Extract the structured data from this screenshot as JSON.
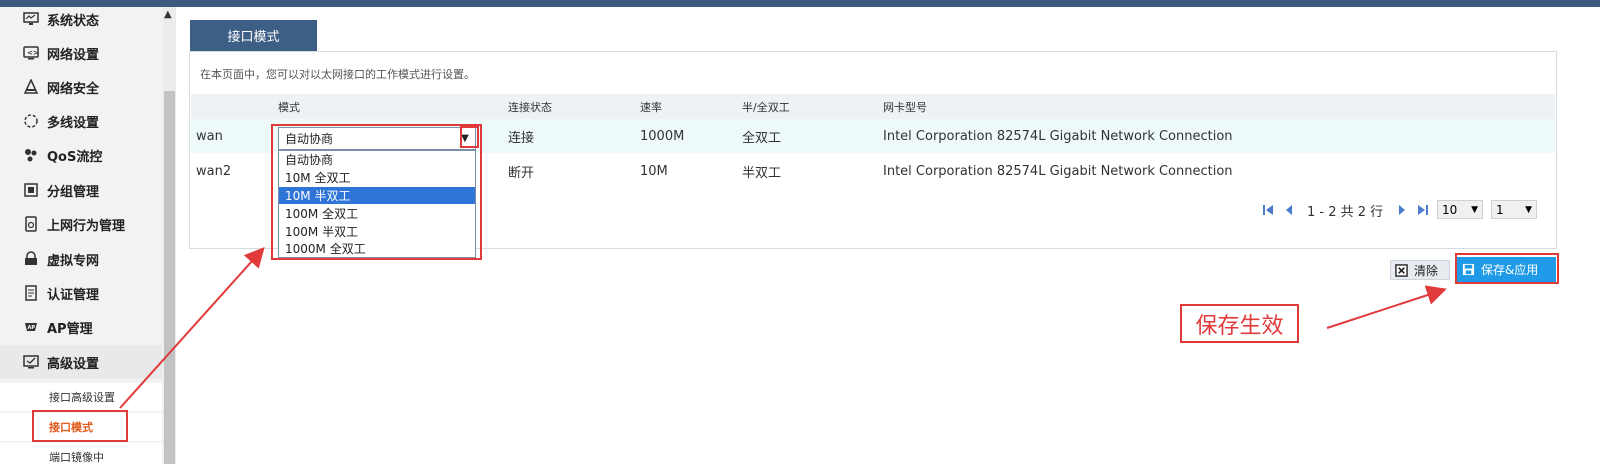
{
  "sidebar": {
    "items": [
      {
        "label": "系统状态",
        "icon": "monitor-icon"
      },
      {
        "label": "网络设置",
        "icon": "network-settings-icon"
      },
      {
        "label": "网络安全",
        "icon": "security-icon"
      },
      {
        "label": "多线设置",
        "icon": "multiline-icon"
      },
      {
        "label": "QoS流控",
        "icon": "qos-icon"
      },
      {
        "label": "分组管理",
        "icon": "group-icon"
      },
      {
        "label": "上网行为管理",
        "icon": "behavior-icon"
      },
      {
        "label": "虚拟专网",
        "icon": "vpn-lock-icon"
      },
      {
        "label": "认证管理",
        "icon": "auth-icon"
      },
      {
        "label": "AP管理",
        "icon": "ap-icon"
      },
      {
        "label": "高级设置",
        "icon": "advanced-icon"
      }
    ],
    "sub_items": [
      "接口高级设置",
      "接口模式",
      "端口镜像中"
    ]
  },
  "tab": {
    "label": "接口模式"
  },
  "description": "在本页面中，您可以对以太网接口的工作模式进行设置。",
  "table": {
    "headers": [
      "",
      "模式",
      "连接状态",
      "速率",
      "半/全双工",
      "网卡型号"
    ],
    "rows": [
      {
        "name": "wan",
        "mode": "自动协商",
        "conn": "连接",
        "speed": "1000M",
        "duplex": "全双工",
        "nic": "Intel Corporation 82574L Gigabit Network Connection"
      },
      {
        "name": "wan2",
        "mode": "",
        "conn": "断开",
        "speed": "10M",
        "duplex": "半双工",
        "nic": "Intel Corporation 82574L Gigabit Network Connection"
      }
    ]
  },
  "dropdown": {
    "options": [
      "自动协商",
      "10M 全双工",
      "10M 半双工",
      "100M 全双工",
      "100M 半双工",
      "1000M 全双工"
    ],
    "highlighted_index": 2
  },
  "pager": {
    "summary": "1 - 2 共 2 行",
    "page_size": "10",
    "page": "1"
  },
  "buttons": {
    "clear": "清除",
    "save": "保存&应用"
  },
  "annotation": {
    "text": "保存生效"
  },
  "colors": {
    "accent": "#3d5f86",
    "save": "#1f9ae8",
    "annotation": "#e13a3a",
    "active_sub": "#e05a1c"
  }
}
